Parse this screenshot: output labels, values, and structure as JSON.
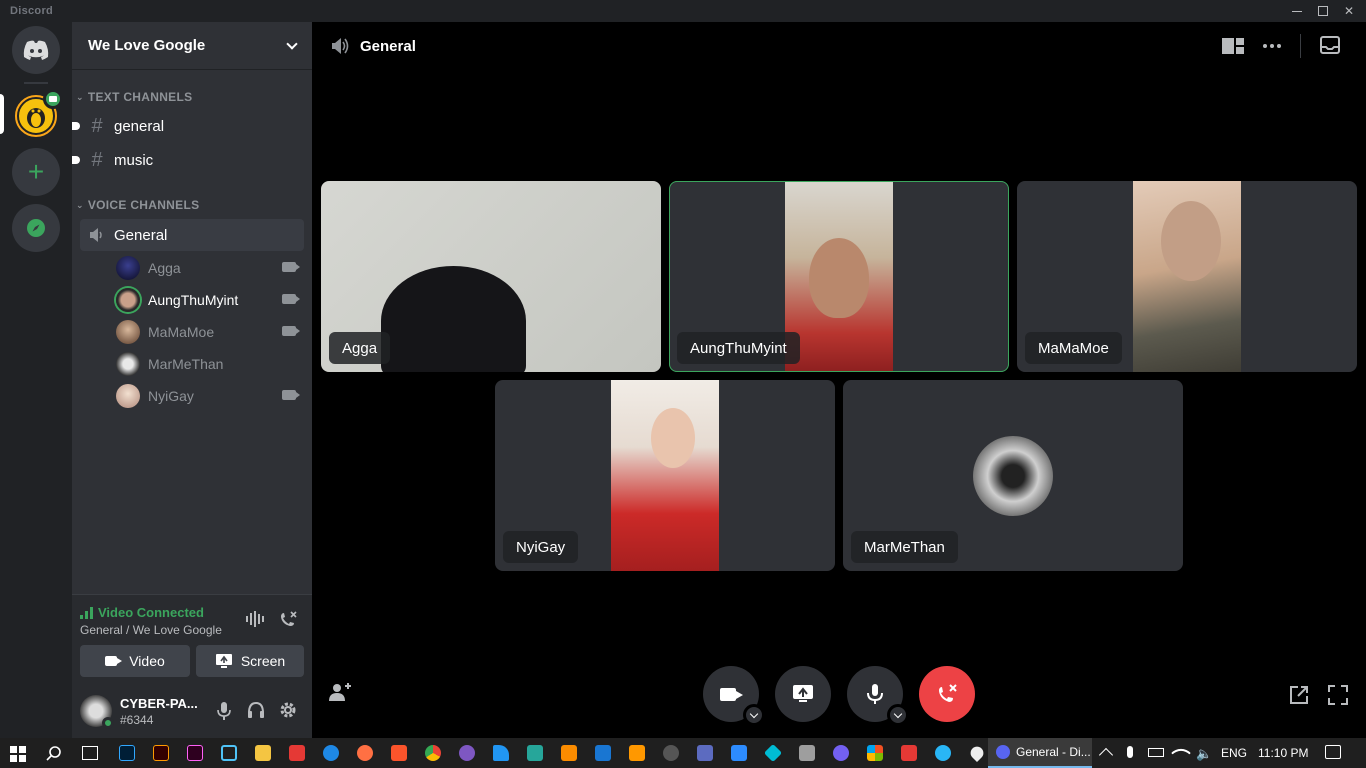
{
  "titlebar": {
    "app_name": "Discord"
  },
  "server": {
    "name": "We Love Google",
    "text_category": "TEXT CHANNELS",
    "text_channels": [
      {
        "name": "general"
      },
      {
        "name": "music"
      }
    ],
    "voice_category": "VOICE CHANNELS",
    "voice_channel": "General",
    "voice_users": [
      {
        "name": "Agga",
        "video": true
      },
      {
        "name": "AungThuMyint",
        "video": true,
        "speaking": true
      },
      {
        "name": "MaMaMoe",
        "video": true
      },
      {
        "name": "MarMeThan",
        "video": false
      },
      {
        "name": "NyiGay",
        "video": true
      }
    ]
  },
  "voice_status": {
    "status": "Video Connected",
    "location": "General / We Love Google",
    "video_label": "Video",
    "screen_label": "Screen"
  },
  "user": {
    "name": "CYBER-PA...",
    "tag": "#6344"
  },
  "call": {
    "channel_title": "General",
    "tiles": [
      {
        "name": "Agga"
      },
      {
        "name": "AungThuMyint"
      },
      {
        "name": "MaMaMoe"
      },
      {
        "name": "NyiGay"
      },
      {
        "name": "MarMeThan"
      }
    ]
  },
  "taskbar": {
    "discord_task": "General - Di...",
    "language": "ENG",
    "time": "11:10 PM"
  },
  "colors": {
    "accent_green": "#3ba55d",
    "hangup_red": "#ed4245",
    "blurple": "#5865f2"
  }
}
